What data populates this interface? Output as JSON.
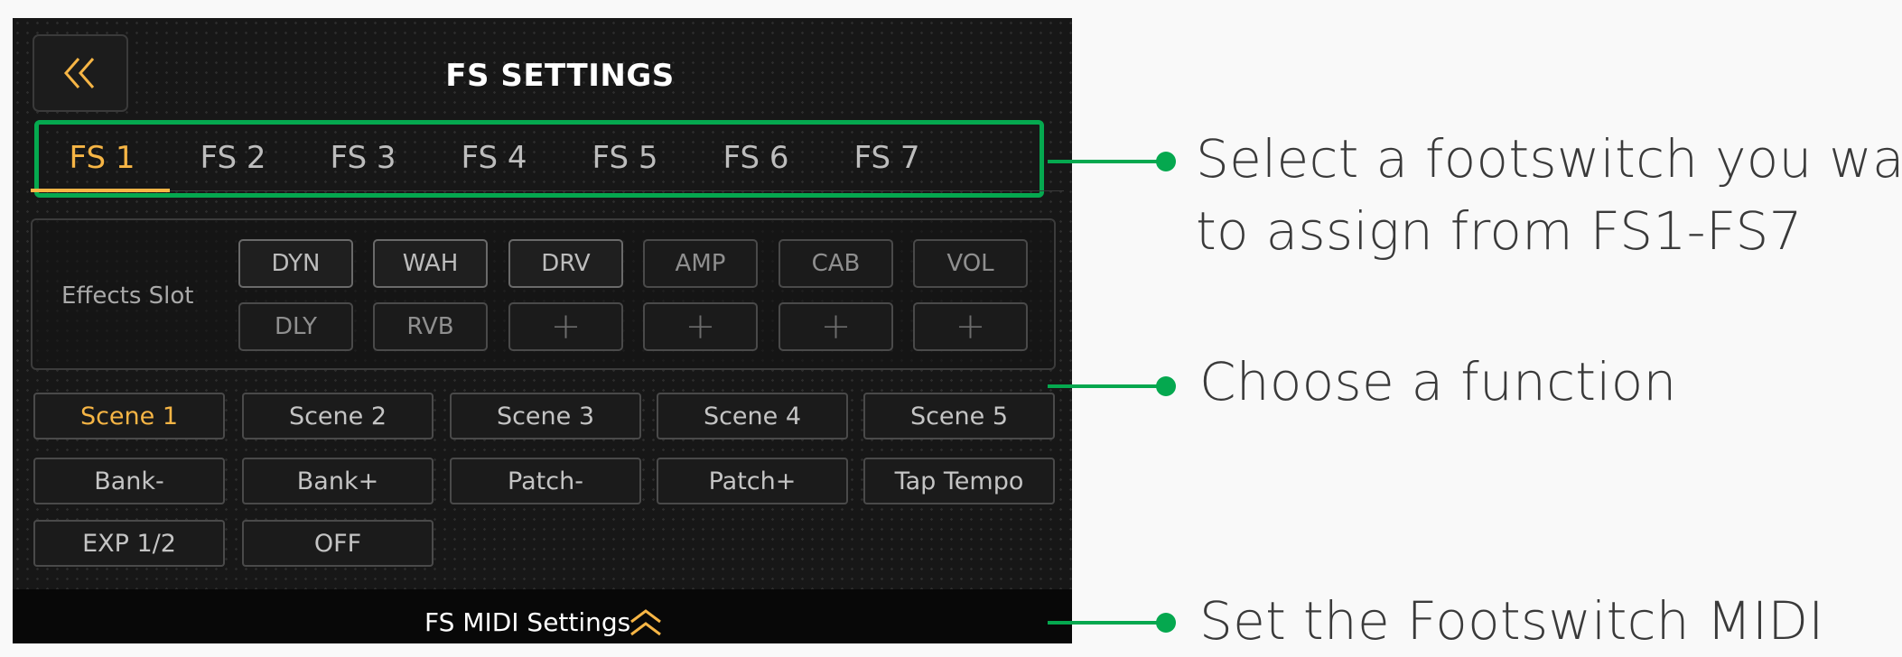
{
  "header": {
    "title": "FS SETTINGS"
  },
  "tabs": [
    {
      "label": "FS 1",
      "active": true
    },
    {
      "label": "FS 2"
    },
    {
      "label": "FS 3"
    },
    {
      "label": "FS 4"
    },
    {
      "label": "FS 5"
    },
    {
      "label": "FS 6"
    },
    {
      "label": "FS 7"
    }
  ],
  "effects": {
    "label": "Effects Slot",
    "slots": [
      "DYN",
      "WAH",
      "DRV",
      "AMP",
      "CAB",
      "VOL",
      "DLY",
      "RVB",
      "+",
      "+",
      "+",
      "+"
    ]
  },
  "functions": [
    {
      "label": "Scene 1",
      "active": true
    },
    {
      "label": "Scene 2"
    },
    {
      "label": "Scene 3"
    },
    {
      "label": "Scene 4"
    },
    {
      "label": "Scene 5"
    },
    {
      "label": "Bank-"
    },
    {
      "label": "Bank+"
    },
    {
      "label": "Patch-"
    },
    {
      "label": "Patch+"
    },
    {
      "label": "Tap Tempo"
    },
    {
      "label": "EXP 1/2"
    },
    {
      "label": "OFF"
    }
  ],
  "footer": {
    "midi_label": "FS MIDI Settings"
  },
  "callouts": {
    "select_line1": "Select a footswitch you want",
    "select_line2": "to assign from FS1-FS7",
    "function": "Choose a function",
    "midi": "Set the Footswitch MIDI"
  },
  "colors": {
    "accent": "#f6b545",
    "callout_green": "#05a84f",
    "screen_bg": "#171717"
  },
  "icons": {
    "back": "double-chevron-left-icon",
    "expand": "double-chevron-up-icon"
  }
}
